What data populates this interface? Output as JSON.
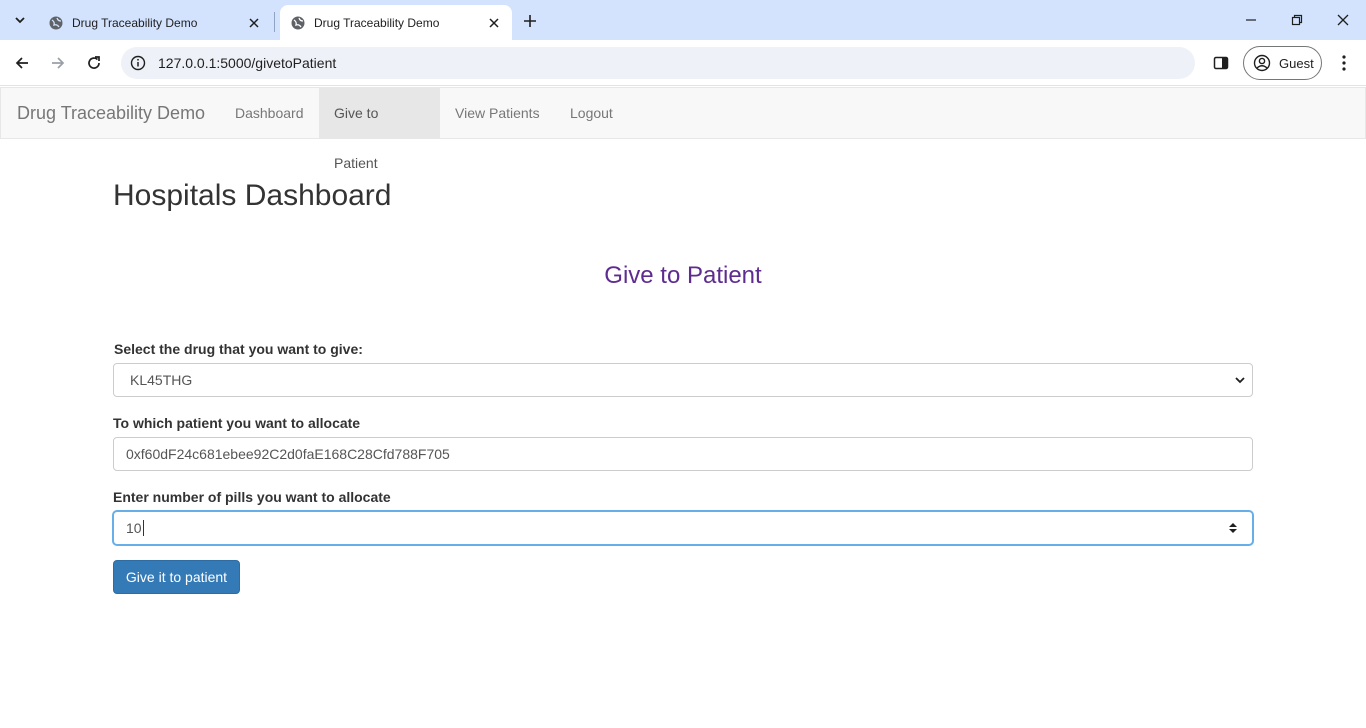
{
  "browser": {
    "tabs": [
      {
        "title": "Drug Traceability Demo",
        "active": false
      },
      {
        "title": "Drug Traceability Demo",
        "active": true
      }
    ],
    "url": "127.0.0.1:5000/givetoPatient",
    "profile_label": "Guest",
    "accent": "#d3e3fd"
  },
  "navbar": {
    "brand": "Drug Traceability Demo",
    "links": [
      {
        "label": "Dashboard"
      },
      {
        "label": "Give to Patient"
      },
      {
        "label": "View Patients"
      },
      {
        "label": "Logout"
      }
    ]
  },
  "main": {
    "title": "Hospitals Dashboard",
    "subtitle": "Give to Patient",
    "subtitle_color": "#5e2c90",
    "form": {
      "drug_label": "Select the drug that you want to give:",
      "drug_value": "KL45THG",
      "patient_label": "To which patient you want to allocate",
      "patient_value": "0xf60dF24c681ebee92C2d0faE168C28Cfd788F705",
      "pills_label": "Enter number of pills you want to allocate",
      "pills_value": "10",
      "submit_label": "Give it to patient",
      "button_color": "#337ab7"
    }
  }
}
